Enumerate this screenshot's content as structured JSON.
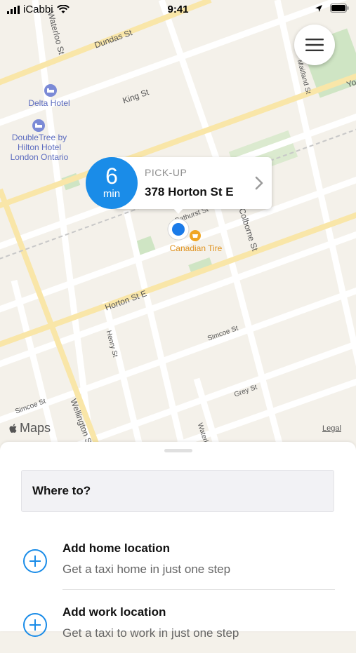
{
  "status_bar": {
    "carrier": "iCabbi",
    "time": "9:41"
  },
  "map": {
    "streets": [
      "Dundas St",
      "King St",
      "Horton St E",
      "Simcoe St",
      "Simcoe St",
      "Grey St",
      "Wellington St",
      "Henry St",
      "Waterloo St",
      "Colborne St",
      "Bathurst St",
      "Waterloo St",
      "Yo",
      "Maitland St"
    ],
    "pois": {
      "delta": "Delta Hotel",
      "doubletree": "DoubleTree by\nHilton Hotel\nLondon Ontario",
      "canadian_tire": "Canadian Tire"
    },
    "attribution": {
      "maps": "Maps",
      "legal": "Legal"
    }
  },
  "pickup": {
    "eta_value": "6",
    "eta_unit": "min",
    "label": "PICK-UP",
    "address": "378 Horton St E"
  },
  "sheet": {
    "search_label": "Where to?",
    "home": {
      "title": "Add home location",
      "subtitle": "Get a taxi home in just one step"
    },
    "work": {
      "title": "Add work location",
      "subtitle": "Get a taxi to work in just one step"
    }
  },
  "colors": {
    "accent": "#1a8ce8",
    "major_road": "#f9e6a8",
    "road": "#ffffff",
    "park": "#cfe5c4",
    "map_bg": "#f4f1ea"
  },
  "icons": [
    "signal-icon",
    "wifi-icon",
    "location-arrow-icon",
    "battery-icon",
    "hamburger-menu-icon",
    "chevron-right-icon",
    "hotel-icon",
    "shopping-icon",
    "apple-icon",
    "add-circle-icon"
  ]
}
